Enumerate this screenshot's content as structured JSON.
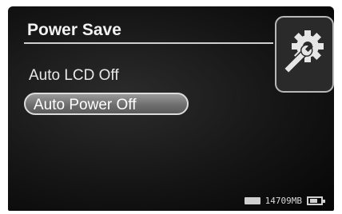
{
  "screen": {
    "title": "Power Save",
    "settings_icon": "gear-wrench-icon"
  },
  "menu": {
    "items": [
      {
        "label": "Auto LCD Off",
        "selected": false
      },
      {
        "label": "Auto Power Off",
        "selected": true
      }
    ]
  },
  "status_bar": {
    "storage_icon": "memory-card-icon",
    "storage_remaining": "14709MB",
    "battery_icon": "battery-icon",
    "battery_level": 0.75
  },
  "colors": {
    "background": "#151515",
    "text": "#f2f2f2",
    "selection": "#7a7a7a"
  }
}
